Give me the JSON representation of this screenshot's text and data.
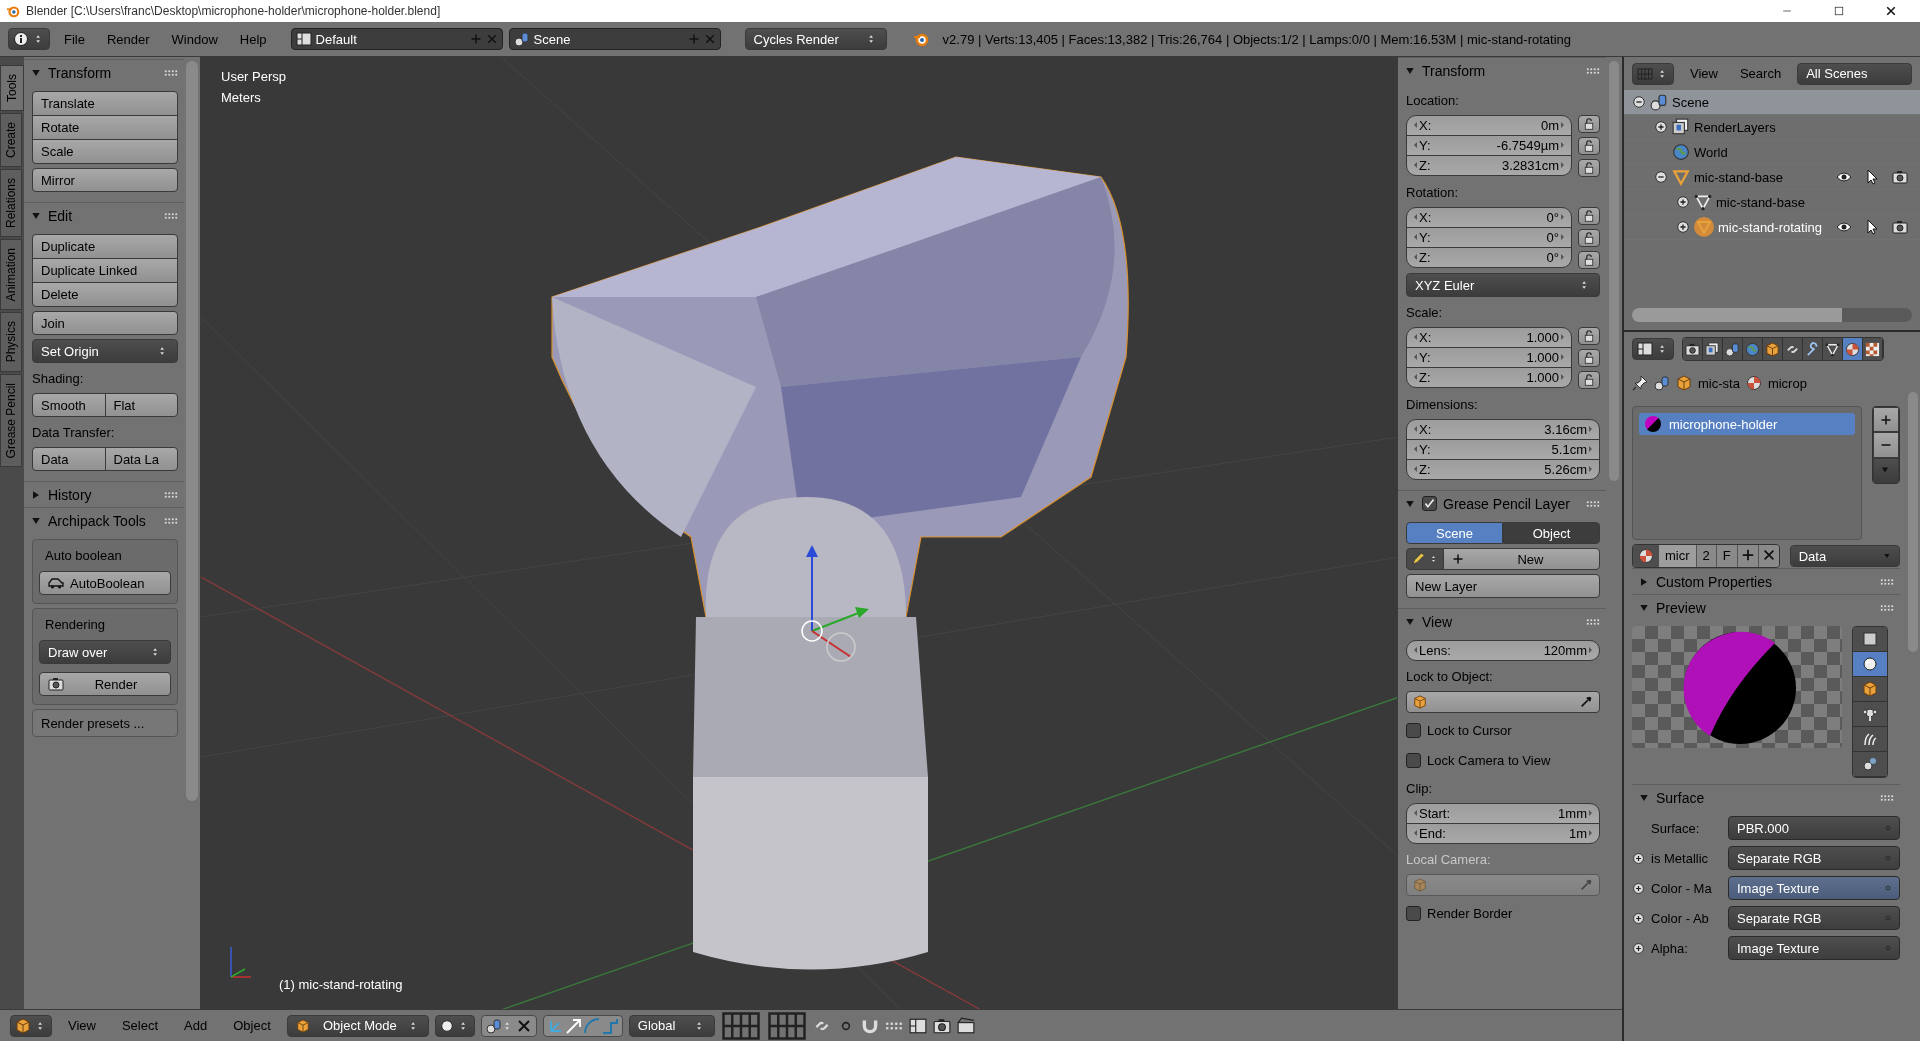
{
  "title_bar": {
    "title": "Blender [C:\\Users\\franc\\Desktop\\microphone-holder\\microphone-holder.blend]"
  },
  "header": {
    "menus": [
      "File",
      "Render",
      "Window",
      "Help"
    ],
    "screen_layout": "Default",
    "scene": "Scene",
    "render_engine": "Cycles Render",
    "stats": "v2.79 | Verts:13,405 | Faces:13,382 | Tris:26,764 | Objects:1/2 | Lamps:0/0 | Mem:16.53M | mic-stand-rotating"
  },
  "tool_tabs": [
    {
      "label": "Tools",
      "selected": true
    },
    {
      "label": "Create",
      "selected": false
    },
    {
      "label": "Relations",
      "selected": false
    },
    {
      "label": "Animation",
      "selected": false
    },
    {
      "label": "Physics",
      "selected": false
    },
    {
      "label": "Grease Pencil",
      "selected": false
    }
  ],
  "tool_shelf": [
    {
      "title": "Transform",
      "expanded": true,
      "rows": [
        {
          "kind": "stack",
          "labels": [
            "Translate",
            "Rotate",
            "Scale"
          ]
        },
        {
          "kind": "button",
          "label": "Mirror"
        }
      ]
    },
    {
      "title": "Edit",
      "expanded": true,
      "rows": [
        {
          "kind": "stack",
          "labels": [
            "Duplicate",
            "Duplicate Linked",
            "Delete"
          ]
        },
        {
          "kind": "button",
          "label": "Join"
        },
        {
          "kind": "dropdown",
          "label": "Set Origin"
        },
        {
          "kind": "label",
          "label": "Shading:"
        },
        {
          "kind": "pair",
          "labels": [
            "Smooth",
            "Flat"
          ]
        },
        {
          "kind": "label",
          "label": "Data Transfer:"
        },
        {
          "kind": "pair",
          "labels": [
            "Data",
            "Data La"
          ]
        }
      ]
    },
    {
      "title": "History",
      "expanded": false
    },
    {
      "title": "Archipack Tools",
      "expanded": true,
      "rows": [
        {
          "kind": "box",
          "title": "Auto boolean",
          "rows": [
            {
              "kind": "boolean_button",
              "label": "AutoBoolean"
            }
          ]
        },
        {
          "kind": "box",
          "title": "Rendering",
          "rows": [
            {
              "kind": "dropdown",
              "label": "Draw over"
            },
            {
              "kind": "render_button",
              "label": "Render"
            }
          ]
        },
        {
          "kind": "box_button",
          "label": "Render presets ..."
        }
      ]
    }
  ],
  "viewport": {
    "view_name": "User Persp",
    "units": "Meters",
    "active_object": "(1) mic-stand-rotating"
  },
  "n_panel": [
    {
      "title": "Transform",
      "expanded": true,
      "rows": [
        {
          "kind": "label",
          "label": "Location:"
        },
        {
          "kind": "vector",
          "locks": true,
          "fields": [
            {
              "axis": "X:",
              "value": "0m"
            },
            {
              "axis": "Y:",
              "value": "-6.7549µm"
            },
            {
              "axis": "Z:",
              "value": "3.2831cm"
            }
          ]
        },
        {
          "kind": "label",
          "label": "Rotation:"
        },
        {
          "kind": "vector",
          "locks": true,
          "fields": [
            {
              "axis": "X:",
              "value": "0°"
            },
            {
              "axis": "Y:",
              "value": "0°"
            },
            {
              "axis": "Z:",
              "value": "0°"
            }
          ]
        },
        {
          "kind": "dropdown",
          "label": "XYZ Euler"
        },
        {
          "kind": "label",
          "label": "Scale:"
        },
        {
          "kind": "vector",
          "locks": true,
          "fields": [
            {
              "axis": "X:",
              "value": "1.000"
            },
            {
              "axis": "Y:",
              "value": "1.000"
            },
            {
              "axis": "Z:",
              "value": "1.000"
            }
          ]
        },
        {
          "kind": "label",
          "label": "Dimensions:"
        },
        {
          "kind": "vector",
          "locks": false,
          "fields": [
            {
              "axis": "X:",
              "value": "3.16cm"
            },
            {
              "axis": "Y:",
              "value": "5.1cm"
            },
            {
              "axis": "Z:",
              "value": "5.26cm"
            }
          ]
        }
      ]
    },
    {
      "title": "Grease Pencil Layer",
      "checked": true,
      "expanded": true,
      "rows": [
        {
          "kind": "tabs",
          "items": [
            {
              "label": "Scene",
              "selected": true
            },
            {
              "label": "Object",
              "selected": false
            }
          ]
        },
        {
          "kind": "new_row",
          "label": "New"
        },
        {
          "kind": "button",
          "label": "New Layer"
        }
      ]
    },
    {
      "title": "View",
      "expanded": true,
      "rows": [
        {
          "kind": "vector",
          "locks": false,
          "fields": [
            {
              "axis": "Lens:",
              "value": "120mm"
            }
          ]
        },
        {
          "kind": "object_picker",
          "label": "Lock to Object:",
          "disabled": false
        },
        {
          "kind": "checkbox",
          "label": "Lock to Cursor",
          "checked": false
        },
        {
          "kind": "checkbox",
          "label": "Lock Camera to View",
          "checked": false
        },
        {
          "kind": "label",
          "label": "Clip:"
        },
        {
          "kind": "vector",
          "locks": false,
          "fields": [
            {
              "axis": "Start:",
              "value": "1mm"
            },
            {
              "axis": "End:",
              "value": "1m"
            }
          ]
        },
        {
          "kind": "object_picker",
          "label": "Local Camera:",
          "disabled": true
        },
        {
          "kind": "checkbox",
          "label": "Render Border",
          "checked": false
        }
      ]
    }
  ],
  "outliner": {
    "menus": [
      "View",
      "Search"
    ],
    "display_mode": "All Scenes",
    "tree": [
      {
        "kind": "scene",
        "label": "Scene",
        "selected": true,
        "expanded": true,
        "children": [
          {
            "kind": "render_layers",
            "label": "RenderLayers",
            "selected": false,
            "expanded": false
          },
          {
            "kind": "world",
            "label": "World",
            "selected": false
          },
          {
            "kind": "object",
            "label": "mic-stand-base",
            "selected": false,
            "expanded": true,
            "children": [
              {
                "kind": "mesh",
                "label": "mic-stand-base",
                "selected": false,
                "expanded": false
              },
              {
                "kind": "object",
                "label": "mic-stand-rotating",
                "selected": false,
                "active": true,
                "expanded": false
              }
            ]
          }
        ]
      }
    ]
  },
  "properties": {
    "tabs": [
      {
        "kind": "render",
        "selected": false
      },
      {
        "kind": "layers",
        "selected": false
      },
      {
        "kind": "scene",
        "selected": false
      },
      {
        "kind": "world",
        "selected": false
      },
      {
        "kind": "object",
        "selected": false
      },
      {
        "kind": "constraints",
        "selected": false
      },
      {
        "kind": "modifiers",
        "selected": false
      },
      {
        "kind": "data",
        "selected": false
      },
      {
        "kind": "material",
        "selected": true
      },
      {
        "kind": "texture",
        "selected": false
      }
    ],
    "breadcrumb": [
      "mic-sta",
      "microp"
    ],
    "material_slots": [
      {
        "name": "microphone-holder",
        "selected": true
      }
    ],
    "datablock": {
      "name": "micr",
      "users": "2",
      "fake": "F",
      "link": "Data"
    },
    "panels": [
      {
        "title": "Custom Properties",
        "expanded": false
      },
      {
        "title": "Preview",
        "expanded": true
      },
      {
        "title": "Surface",
        "expanded": true
      }
    ],
    "preview_types": [
      {
        "kind": "flat",
        "selected": false
      },
      {
        "kind": "sphere",
        "selected": true
      },
      {
        "kind": "cube",
        "selected": false
      },
      {
        "kind": "monkey",
        "selected": false
      },
      {
        "kind": "hair",
        "selected": false
      },
      {
        "kind": "sky",
        "selected": false
      }
    ],
    "surface": [
      {
        "kind": "output",
        "label": "Surface:",
        "value": "PBR.000",
        "selected": false
      },
      {
        "kind": "input",
        "label": "is Metallic",
        "value": "Separate RGB",
        "selected": false
      },
      {
        "kind": "input",
        "label": "Color - Ma",
        "value": "Image Texture",
        "selected": true
      },
      {
        "kind": "input",
        "label": "Color - Ab",
        "value": "Separate RGB",
        "selected": false
      },
      {
        "kind": "input",
        "label": "Alpha:",
        "value": "Image Texture",
        "selected": false
      }
    ]
  },
  "bottom_header": {
    "menus": [
      "View",
      "Select",
      "Add",
      "Object"
    ],
    "mode": "Object Mode",
    "orientation": "Global"
  }
}
